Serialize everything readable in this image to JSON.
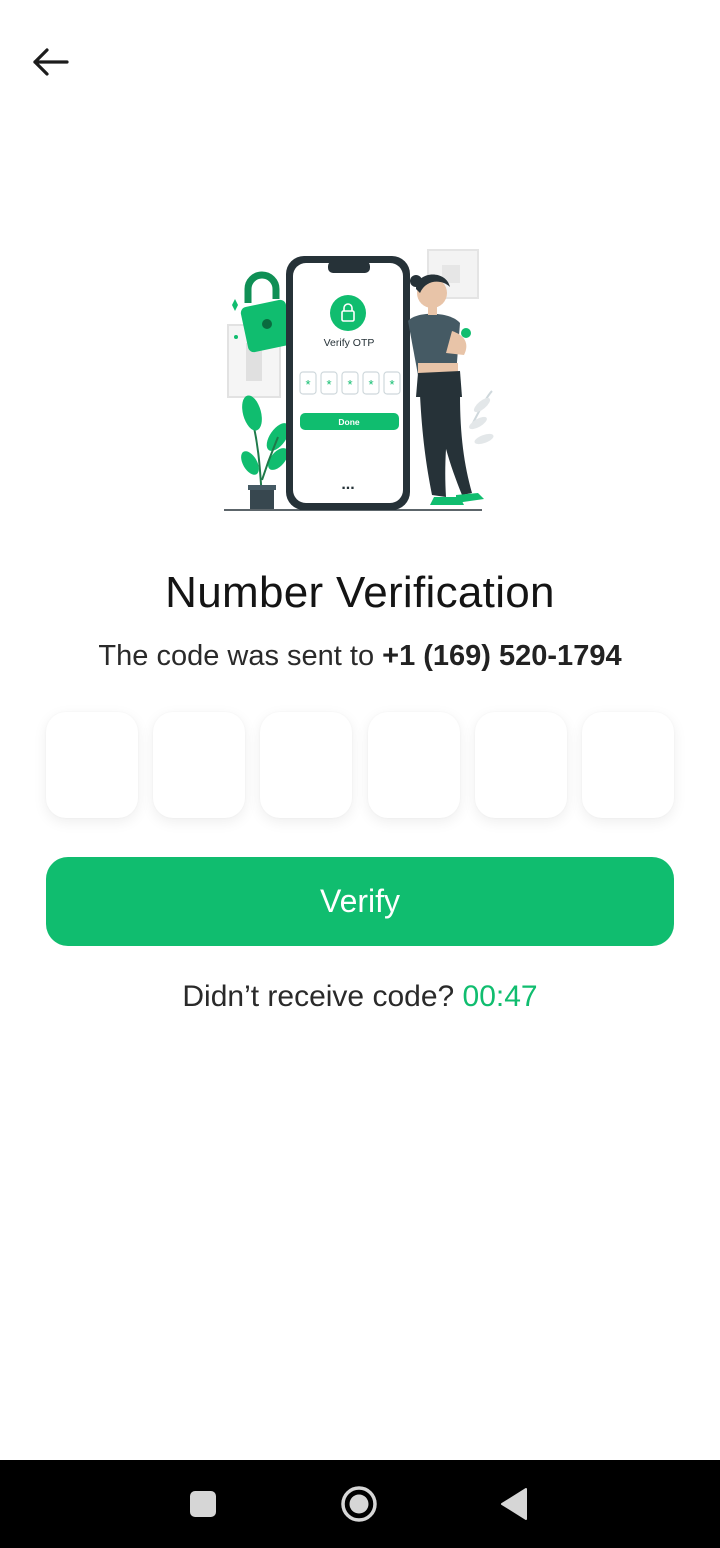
{
  "header": {
    "back_icon": "arrow-left-icon"
  },
  "illustration": {
    "phone_title": "Verify OTP",
    "phone_digits": [
      "*",
      "*",
      "*",
      "*",
      "*"
    ],
    "phone_button_label": "Done",
    "phone_dots": "...",
    "accent_color": "#10bd6f"
  },
  "main": {
    "title": "Number Verification",
    "subtitle_prefix": "The code was sent to",
    "phone_number": "+1 (169) 520-1794",
    "otp_boxes": [
      "",
      "",
      "",
      "",
      "",
      ""
    ],
    "verify_label": "Verify",
    "resend_prefix": "Didn’t receive code?",
    "timer": "00:47"
  },
  "navbar": {
    "recents_icon": "square-icon",
    "home_icon": "circle-home-icon",
    "back_icon": "triangle-back-icon"
  },
  "colors": {
    "accent": "#10bd6f",
    "navbar": "#000000"
  }
}
